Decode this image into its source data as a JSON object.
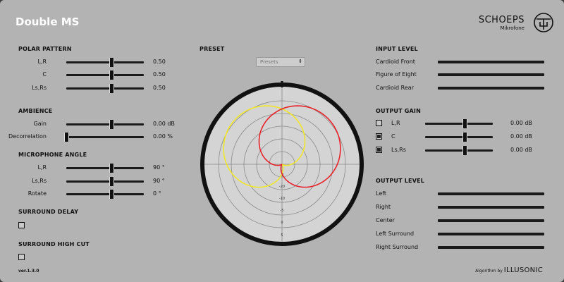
{
  "app": {
    "title": "Double MS",
    "brand": "SCHOEPS",
    "brand_sub": "Mikrofone",
    "version": "ver.1.3.0",
    "algorithm_by": "Algorithm by",
    "algorithm_brand": "ILLUSONIC"
  },
  "polar_pattern": {
    "heading": "POLAR PATTERN",
    "rows": [
      {
        "label": "L,R",
        "value": "0.50",
        "level": 0.58
      },
      {
        "label": "C",
        "value": "0.50",
        "level": 0.58
      },
      {
        "label": "Ls,Rs",
        "value": "0.50",
        "level": 0.58
      }
    ]
  },
  "ambience": {
    "heading": "AMBIENCE",
    "rows": [
      {
        "label": "Gain",
        "value": "0.00 dB",
        "level": 0.58
      },
      {
        "label": "Decorrelation",
        "value": "0.00 %",
        "level": 0.0
      }
    ]
  },
  "microphone_angle": {
    "heading": "MICROPHONE ANGLE",
    "rows": [
      {
        "label": "L,R",
        "value": "90 °",
        "level": 0.58
      },
      {
        "label": "Ls,Rs",
        "value": "90 °",
        "level": 0.58
      },
      {
        "label": "Rotate",
        "value": "0 °",
        "level": 0.58
      }
    ]
  },
  "surround_delay": {
    "heading": "SURROUND DELAY",
    "checked": false
  },
  "surround_high_cut": {
    "heading": "SURROUND HIGH CUT",
    "checked": false
  },
  "preset": {
    "heading": "PRESET",
    "value": "Presets"
  },
  "polar_plot": {
    "ring_labels": [
      "-2",
      "-20",
      "-10",
      "-5",
      "0",
      "5"
    ],
    "colors": {
      "red": "#e8232a",
      "yellow": "#f0e62a"
    }
  },
  "input_level": {
    "heading": "INPUT LEVEL",
    "rows": [
      {
        "label": "Cardioid Front",
        "level": 1.0
      },
      {
        "label": "Figure of Eight",
        "level": 1.0
      },
      {
        "label": "Cardioid Rear",
        "level": 1.0
      }
    ]
  },
  "output_gain": {
    "heading": "OUTPUT GAIN",
    "rows": [
      {
        "label": "L,R",
        "value": "0.00 dB",
        "level": 0.58,
        "checked": false
      },
      {
        "label": "C",
        "value": "0.00 dB",
        "level": 0.58,
        "checked": true
      },
      {
        "label": "Ls,Rs",
        "value": "0.00 dB",
        "level": 0.58,
        "checked": true
      }
    ]
  },
  "output_level": {
    "heading": "OUTPUT LEVEL",
    "rows": [
      {
        "label": "Left",
        "level": 1.0
      },
      {
        "label": "Right",
        "level": 1.0
      },
      {
        "label": "Center",
        "level": 1.0
      },
      {
        "label": "Left Surround",
        "level": 1.0
      },
      {
        "label": "Right Surround",
        "level": 1.0
      }
    ]
  }
}
